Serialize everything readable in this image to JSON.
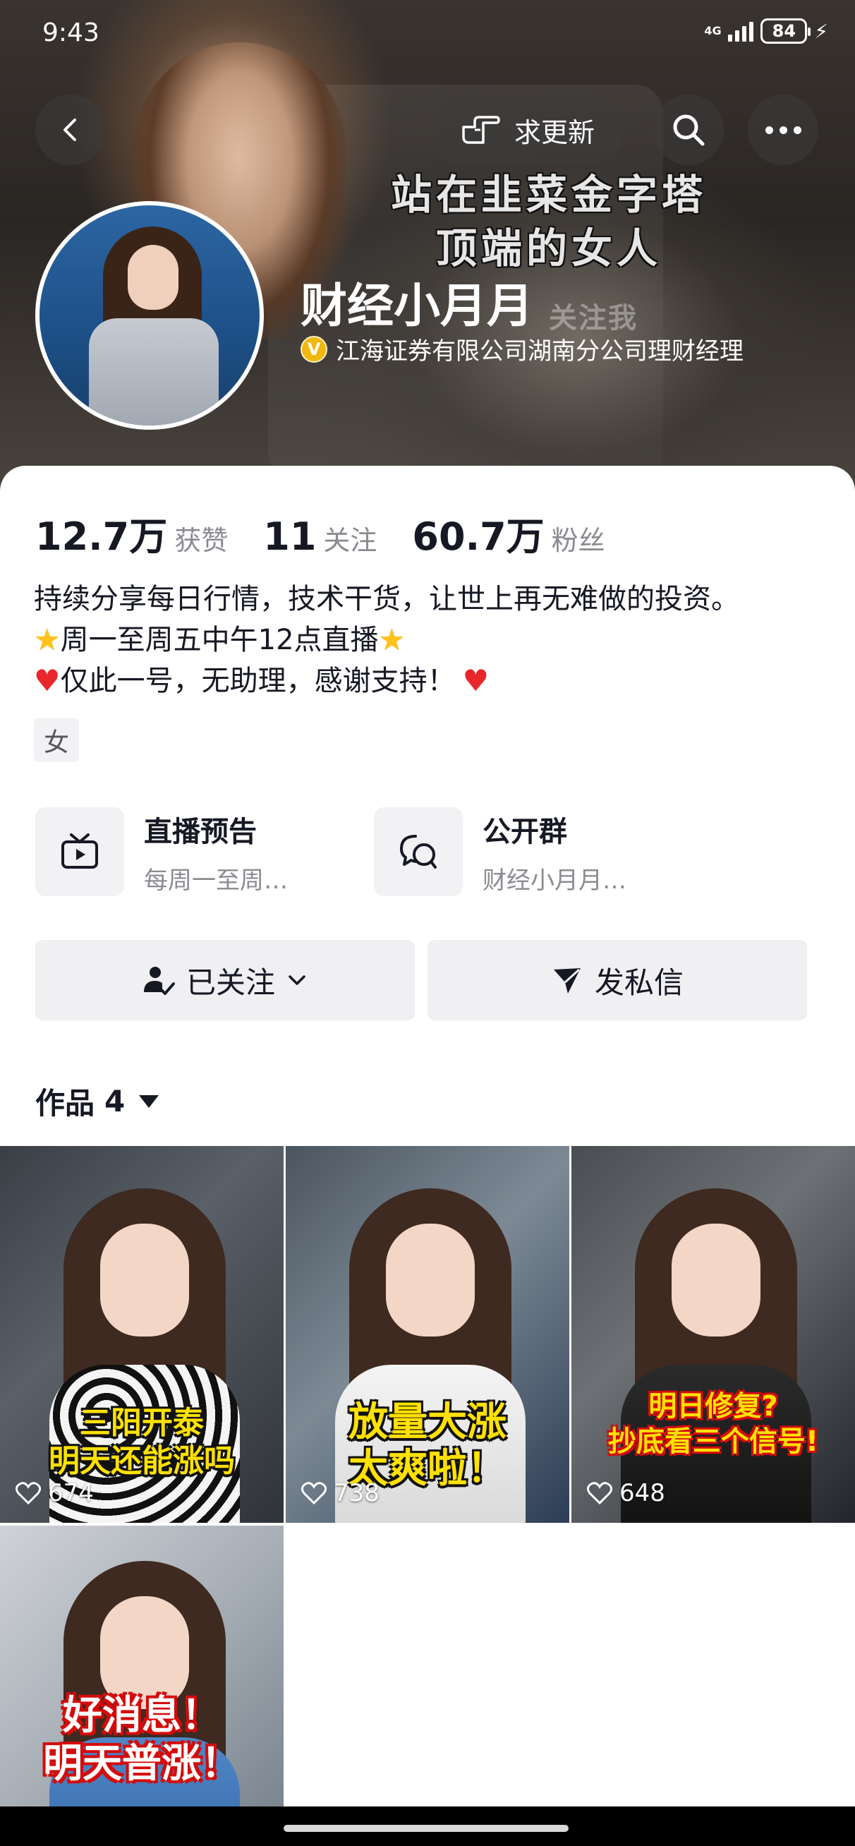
{
  "status_bar": {
    "time": "9:43",
    "network": "4G",
    "battery": "84"
  },
  "nav": {
    "update_label": "求更新"
  },
  "cover": {
    "line1": "站在韭菜金字塔",
    "line2": "顶端的女人",
    "faint": "关注我"
  },
  "profile": {
    "name": "财经小月月",
    "verify_badge": "V",
    "verification": "江海证券有限公司湖南分公司理财经理"
  },
  "stats": [
    {
      "value": "12.7万",
      "label": "获赞"
    },
    {
      "value": "11",
      "label": "关注"
    },
    {
      "value": "60.7万",
      "label": "粉丝"
    }
  ],
  "bio": {
    "line1": "持续分享每日行情，技术干货，让世上再无难做的投资。",
    "line2": "周一至周五中午12点直播",
    "line3": "仅此一号，无助理，感谢支持！"
  },
  "tag": "女",
  "features": [
    {
      "title": "直播预告",
      "subtitle": "每周一至周…",
      "icon": "tv-icon"
    },
    {
      "title": "公开群",
      "subtitle": "财经小月月…",
      "icon": "chat-group-icon"
    }
  ],
  "actions": {
    "follow_label": "已关注",
    "message_label": "发私信"
  },
  "works": {
    "label": "作品",
    "count": "4"
  },
  "videos": [
    {
      "caption1": "三阳开泰",
      "caption2": "明天还能涨吗",
      "likes": "674"
    },
    {
      "caption1": "放量大涨",
      "caption2": "太爽啦！",
      "likes": "738"
    },
    {
      "caption1": "明日修复?",
      "caption2": "抄底看三个信号!",
      "likes": "648"
    },
    {
      "caption1": "好消息！",
      "caption2": "明天普涨！",
      "likes": ""
    }
  ],
  "colors": {
    "verify_badge": "#f2b80f",
    "heart": "#e8262b",
    "star": "#ffc21a",
    "caption_yellow": "#ffe100",
    "caption_red": "#d40b0b"
  }
}
